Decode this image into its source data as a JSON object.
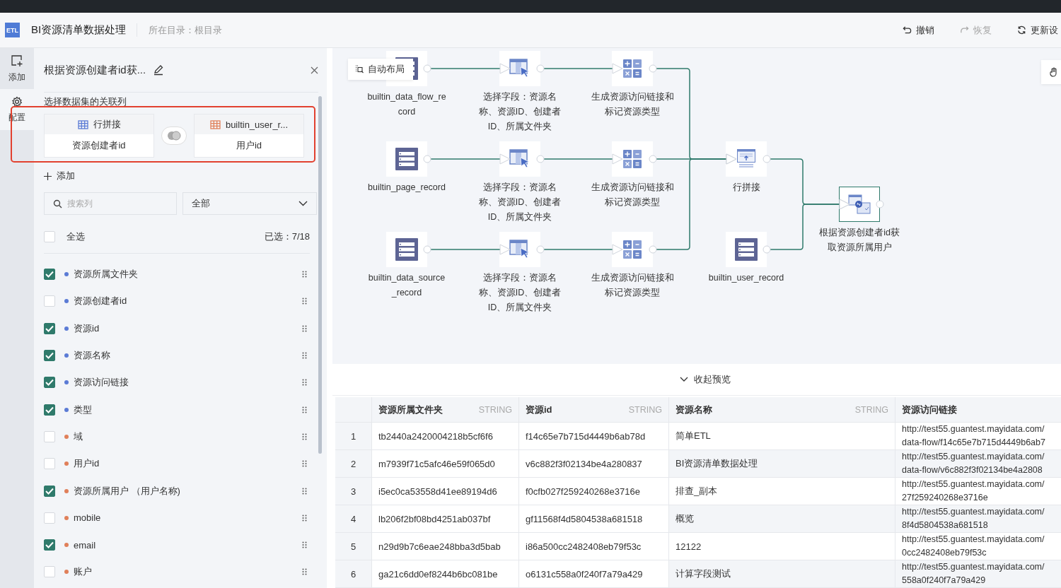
{
  "header": {
    "logo": "ETL",
    "title": "BI资源清单数据处理",
    "location": "所在目录：根目录",
    "actions": [
      {
        "kind": "undo",
        "label": "撤销",
        "disabled": false
      },
      {
        "kind": "redo",
        "label": "恢复",
        "disabled": true
      },
      {
        "kind": "refresh",
        "label": "更新设",
        "disabled": false
      }
    ]
  },
  "rail": [
    {
      "kind": "add",
      "label": "添加",
      "selected": false
    },
    {
      "kind": "config",
      "label": "配置",
      "selected": true
    }
  ],
  "panel": {
    "title": "根据资源创建者id获...",
    "section": "选择数据集的关联列",
    "join": {
      "left": {
        "name": "行拼接",
        "field": "资源创建者id",
        "color": "#5b7bd5"
      },
      "right": {
        "name": "builtin_user_r...",
        "field": "用户id",
        "color": "#e0805a"
      }
    },
    "add_label": "添加",
    "search": {
      "placeholder": "搜索列"
    },
    "filter": "全部",
    "select_all": {
      "label": "全选",
      "checked": false
    },
    "selected_count": "已选：7/18",
    "columns": [
      {
        "name": "资源所属文件夹",
        "checked": true,
        "color": "#5b7bd5"
      },
      {
        "name": "资源创建者id",
        "checked": false,
        "color": "#5b7bd5"
      },
      {
        "name": "资源id",
        "checked": true,
        "color": "#5b7bd5"
      },
      {
        "name": "资源名称",
        "checked": true,
        "color": "#5b7bd5"
      },
      {
        "name": "资源访问链接",
        "checked": true,
        "color": "#5b7bd5"
      },
      {
        "name": "类型",
        "checked": true,
        "color": "#5b7bd5"
      },
      {
        "name": "域",
        "checked": false,
        "color": "#e0805a"
      },
      {
        "name": "用户id",
        "checked": false,
        "color": "#e0805a"
      },
      {
        "name": "资源所属用户 （用户名称)",
        "checked": true,
        "color": "#e0805a"
      },
      {
        "name": "mobile",
        "checked": false,
        "color": "#e0805a"
      },
      {
        "name": "email",
        "checked": true,
        "color": "#e0805a"
      },
      {
        "name": "账户",
        "checked": false,
        "color": "#e0805a"
      }
    ]
  },
  "canvas": {
    "auto_layout": "自动布局",
    "nodes": [
      {
        "kind": "dataset",
        "label": [
          "builtin_data_flow_re",
          "cord"
        ],
        "selected": false
      },
      {
        "kind": "select",
        "label": [
          "选择字段：资源名",
          "称、资源ID、创建者",
          "ID、所属文件夹"
        ],
        "selected": false
      },
      {
        "kind": "calc",
        "label": [
          "生成资源访问链接和",
          "标记资源类型"
        ],
        "selected": false
      },
      {
        "kind": "dataset",
        "label": [
          "builtin_page_record"
        ],
        "selected": false
      },
      {
        "kind": "select",
        "label": [
          "选择字段：资源名",
          "称、资源ID、创建者",
          "ID、所属文件夹"
        ],
        "selected": false
      },
      {
        "kind": "calc",
        "label": [
          "生成资源访问链接和",
          "标记资源类型"
        ],
        "selected": false
      },
      {
        "kind": "union",
        "label": [
          "行拼接"
        ],
        "selected": false
      },
      {
        "kind": "join",
        "label": [
          "根据资源创建者id获",
          "取资源所属用户"
        ],
        "selected": true
      },
      {
        "kind": "dataset",
        "label": [
          "builtin_data_source",
          "_record"
        ],
        "selected": false
      },
      {
        "kind": "select",
        "label": [
          "选择字段：资源名",
          "称、资源ID、创建者",
          "ID、所属文件夹"
        ],
        "selected": false
      },
      {
        "kind": "calc",
        "label": [
          "生成资源访问链接和",
          "标记资源类型"
        ],
        "selected": false
      },
      {
        "kind": "dataset",
        "label": [
          "builtin_user_record"
        ],
        "selected": false
      }
    ]
  },
  "preview": {
    "toggle": "收起预览",
    "columns": [
      {
        "name": "资源所属文件夹",
        "type": "STRING"
      },
      {
        "name": "资源id",
        "type": "STRING"
      },
      {
        "name": "资源名称",
        "type": "STRING"
      },
      {
        "name": "资源访问链接"
      }
    ],
    "rows": [
      {
        "index": "1",
        "cells": [
          "tb2440a2420004218b5cf6f6",
          "f14c65e7b715d4449b6ab78d",
          "简单ETL"
        ],
        "link": [
          "http://test55.guantest.mayidata.com/",
          "data-flow/f14c65e7b715d4449b6ab7"
        ]
      },
      {
        "index": "2",
        "cells": [
          "m7939f71c5afc46e59f065d0",
          "v6c882f3f02134be4a280837",
          "BI资源清单数据处理"
        ],
        "link": [
          "http://test55.guantest.mayidata.com/",
          "data-flow/v6c882f3f02134be4a2808"
        ]
      },
      {
        "index": "3",
        "cells": [
          "i5ec0ca53558d41ee89194d6",
          "f0cfb027f259240268e3716e",
          "排查_副本"
        ],
        "link": [
          "http://test55.guantest.mayidata.com/",
          "27f259240268e3716e"
        ]
      },
      {
        "index": "4",
        "cells": [
          "lb206f2bf08bd4251ab037bf",
          "gf11568f4d5804538a681518",
          "概览"
        ],
        "link": [
          "http://test55.guantest.mayidata.com/",
          "8f4d5804538a681518"
        ]
      },
      {
        "index": "5",
        "cells": [
          "n29d9b7c6eae248bba3d5bab",
          "i86a500cc2482408eb79f53c",
          "12122"
        ],
        "link": [
          "http://test55.guantest.mayidata.com/",
          "0cc2482408eb79f53c"
        ]
      },
      {
        "index": "6",
        "cells": [
          "ga21c6dd0ef8244b6bc081be",
          "o6131c558a0f240f7a79a429",
          "计算字段测试"
        ],
        "link": [
          "http://test55.guantest.mayidata.com/",
          "558a0f240f7a79a429"
        ]
      }
    ]
  }
}
